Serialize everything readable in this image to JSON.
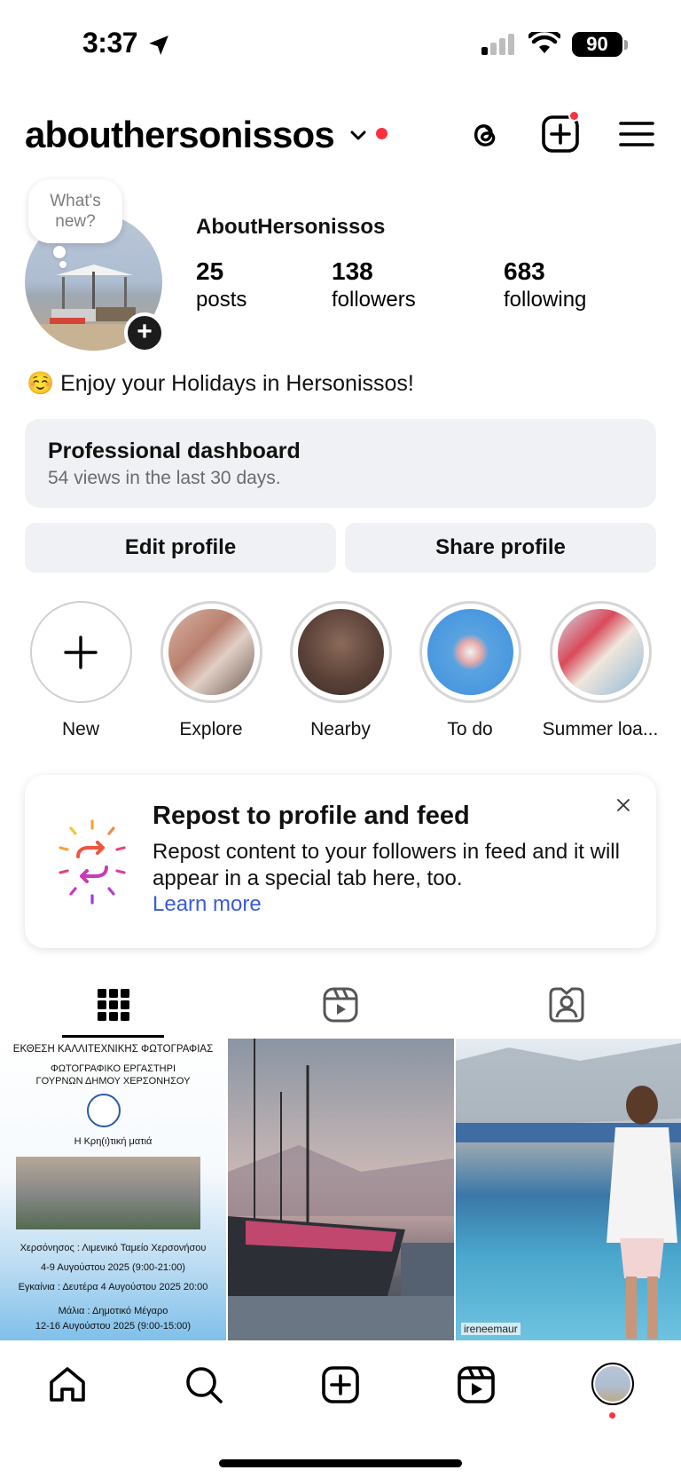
{
  "status_bar": {
    "time": "3:37",
    "battery": "90"
  },
  "header": {
    "username": "abouthersonissos"
  },
  "profile": {
    "whats_new": "What's new?",
    "display_name": "AboutHersonissos",
    "stats": {
      "posts": {
        "count": "25",
        "label": "posts"
      },
      "followers": {
        "count": "138",
        "label": "followers"
      },
      "following": {
        "count": "683",
        "label": "following"
      }
    },
    "bio": "☺️ Enjoy your Holidays in Hersonissos!",
    "dashboard": {
      "title": "Professional dashboard",
      "subtitle": "54 views in the last 30 days."
    },
    "buttons": {
      "edit": "Edit profile",
      "share": "Share profile"
    }
  },
  "highlights": [
    {
      "label": "New"
    },
    {
      "label": "Explore"
    },
    {
      "label": "Nearby"
    },
    {
      "label": "To do"
    },
    {
      "label": "Summer loa..."
    }
  ],
  "repost_card": {
    "title": "Repost to profile and feed",
    "text": "Repost content to your followers in feed and it will appear in a special tab here, too.",
    "link": "Learn more"
  },
  "grid_posts": {
    "post1": {
      "line1": "ΕΚΘΕΣΗ ΚΑΛΛΙΤΕΧΝΙΚΗΣ ΦΩΤΟΓΡΑΦΙΑΣ",
      "line2": "ΦΩΤΟΓΡΑΦΙΚΟ ΕΡΓΑΣΤΗΡΙ ΓΟΥΡΝΩΝ ΔΗΜΟΥ ΧΕΡΣΟΝΗΣΟΥ",
      "line3": "Η Κρη(ι)τική ματιά",
      "line4": "Χερσόνησος : Λιμενικό Ταμείο Χερσονήσου",
      "line5": "4-9 Αυγούστου 2025 (9:00-21:00)",
      "line6": "Εγκαίνια : Δευτέρα 4 Αυγούστου 2025 20:00",
      "line7": "Μάλια : Δημοτικό Μέγαρο",
      "line8": "12-16 Αυγούστου 2025 (9:00-15:00)"
    },
    "post3": {
      "caption": "ireneemaur"
    }
  },
  "colors": {
    "accent_red": "#ff3040",
    "link_blue": "#3b5bdb",
    "panel_gray": "#eff1f4"
  }
}
